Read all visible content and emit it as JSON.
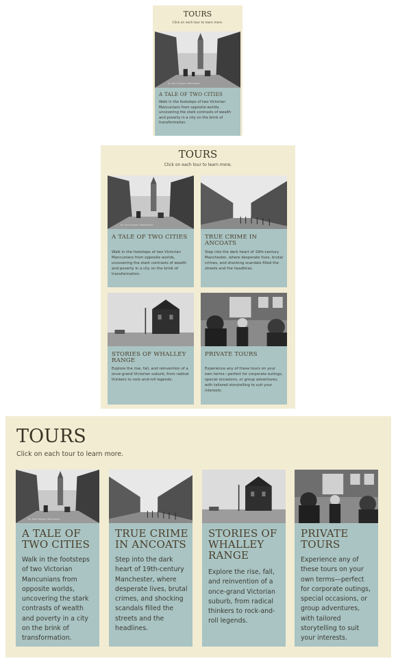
{
  "heading": "TOURS",
  "subheading": "Click on each tour to learn more.",
  "photo_captions": {
    "street": "St. Ann's Square, Manchester"
  },
  "tours": [
    {
      "title": "A Tale of Two Cities",
      "description": "Walk in the footsteps of two Victorian Mancunians from opposite worlds, uncovering the stark contrasts of wealth and poverty in a city on the brink of transformation.",
      "image": "victorian-street-photo"
    },
    {
      "title": "True Crime in Ancoats",
      "description": "Step into the dark heart of 19th-century Manchester, where desperate lives, brutal crimes, and shocking scandals filled the streets and the headlines.",
      "image": "terraced-houses-photo"
    },
    {
      "title": "Stories of Whalley Range",
      "description": "Explore the rise, fall, and reinvention of a once-grand Victorian suburb, from radical thinkers to rock-and-roll legends.",
      "image": "victorian-mansion-photo"
    },
    {
      "title": "Private Tours",
      "description": "Experience any of these tours on your own terms—perfect for corporate outings, special occasions, or group adventures, with tailored storytelling to suit your interests.",
      "image": "pub-crowd-photo"
    }
  ]
}
